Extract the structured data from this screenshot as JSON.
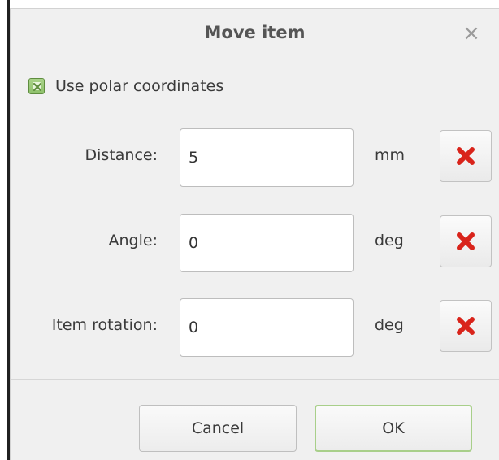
{
  "dialog": {
    "title": "Move item",
    "close_icon": "close-icon"
  },
  "polar": {
    "label": "Use polar coordinates",
    "checked": true
  },
  "fields": [
    {
      "label": "Distance:",
      "value": "5",
      "unit": "mm",
      "clear_icon": "red-x-icon"
    },
    {
      "label": "Angle:",
      "value": "0",
      "unit": "deg",
      "clear_icon": "red-x-icon"
    },
    {
      "label": "Item rotation:",
      "value": "0",
      "unit": "deg",
      "clear_icon": "red-x-icon"
    }
  ],
  "buttons": {
    "cancel": "Cancel",
    "ok": "OK"
  },
  "colors": {
    "accent_green": "#8ec16b",
    "clear_red": "#d9241b"
  }
}
